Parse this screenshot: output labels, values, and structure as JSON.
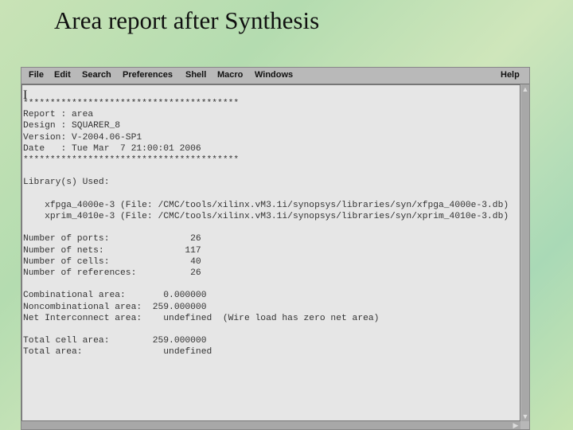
{
  "slide_title": "Area report after Synthesis",
  "menu": [
    "File",
    "Edit",
    "Search",
    "Preferences",
    "Shell",
    "Macro",
    "Windows"
  ],
  "help": "Help",
  "report_lines": [
    "****************************************",
    "Report : area",
    "Design : SQUARER_8",
    "Version: V-2004.06-SP1",
    "Date   : Tue Mar  7 21:00:01 2006",
    "****************************************",
    "",
    "Library(s) Used:",
    "",
    "    xfpga_4000e-3 (File: /CMC/tools/xilinx.vM3.1i/synopsys/libraries/syn/xfpga_4000e-3.db)",
    "    xprim_4010e-3 (File: /CMC/tools/xilinx.vM3.1i/synopsys/libraries/syn/xprim_4010e-3.db)",
    "",
    "Number of ports:               26",
    "Number of nets:               117",
    "Number of cells:               40",
    "Number of references:          26",
    "",
    "Combinational area:       0.000000",
    "Noncombinational area:  259.000000",
    "Net Interconnect area:    undefined  (Wire load has zero net area)",
    "",
    "Total cell area:        259.000000",
    "Total area:               undefined"
  ]
}
